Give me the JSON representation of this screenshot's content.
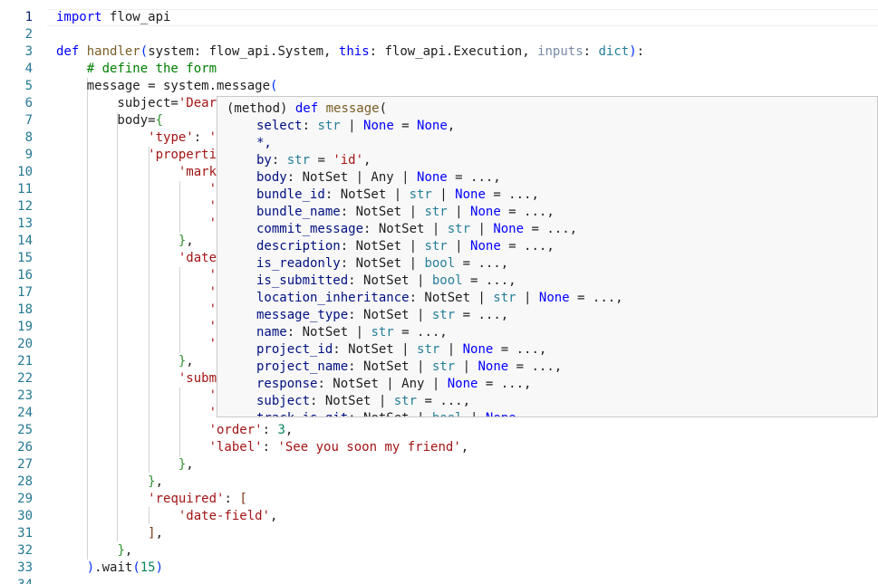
{
  "editor": {
    "active_line": 1,
    "lines": [
      {
        "n": "1",
        "text": "import flow_api"
      },
      {
        "n": "2",
        "text": ""
      },
      {
        "n": "3",
        "text": "def handler(system: flow_api.System, this: flow_api.Execution, inputs: dict):"
      },
      {
        "n": "4",
        "text": "    # define the form"
      },
      {
        "n": "5",
        "text": "    message = system.message("
      },
      {
        "n": "6",
        "text": "        subject='Dear"
      },
      {
        "n": "7",
        "text": "        body={"
      },
      {
        "n": "8",
        "text": "            'type': '"
      },
      {
        "n": "9",
        "text": "            'properti"
      },
      {
        "n": "10",
        "text": "                'mark"
      },
      {
        "n": "11",
        "text": "                    '"
      },
      {
        "n": "12",
        "text": "                    '"
      },
      {
        "n": "13",
        "text": "                    '"
      },
      {
        "n": "14",
        "text": "                },"
      },
      {
        "n": "15",
        "text": "                'date"
      },
      {
        "n": "16",
        "text": "                    '"
      },
      {
        "n": "17",
        "text": "                    '"
      },
      {
        "n": "18",
        "text": "                    '"
      },
      {
        "n": "19",
        "text": "                    '"
      },
      {
        "n": "20",
        "text": "                    '"
      },
      {
        "n": "21",
        "text": "                },"
      },
      {
        "n": "22",
        "text": "                'subm"
      },
      {
        "n": "23",
        "text": "                    '"
      },
      {
        "n": "24",
        "text": "                    '"
      },
      {
        "n": "25",
        "text": "                    'order': 3,"
      },
      {
        "n": "26",
        "text": "                    'label': 'See you soon my friend',"
      },
      {
        "n": "27",
        "text": "                },"
      },
      {
        "n": "28",
        "text": "            },"
      },
      {
        "n": "29",
        "text": "            'required': ["
      },
      {
        "n": "30",
        "text": "                'date-field',"
      },
      {
        "n": "31",
        "text": "            ],"
      },
      {
        "n": "32",
        "text": "        },"
      },
      {
        "n": "33",
        "text": "    ).wait(15)"
      },
      {
        "n": "34",
        "text": ""
      }
    ]
  },
  "hover": {
    "header_prefix": "(method) ",
    "header_kw": "def",
    "header_fn": "message",
    "header_paren": "(",
    "params": [
      {
        "name": "select",
        "sig": ": str | None = None,"
      },
      {
        "name": "*,",
        "sig": ""
      },
      {
        "name": "by",
        "sig": ": str = 'id',"
      },
      {
        "name": "body",
        "sig": ": NotSet | Any | None = ...,"
      },
      {
        "name": "bundle_id",
        "sig": ": NotSet | str | None = ...,"
      },
      {
        "name": "bundle_name",
        "sig": ": NotSet | str | None = ...,"
      },
      {
        "name": "commit_message",
        "sig": ": NotSet | str | None = ...,"
      },
      {
        "name": "description",
        "sig": ": NotSet | str | None = ...,"
      },
      {
        "name": "is_readonly",
        "sig": ": NotSet | bool = ...,"
      },
      {
        "name": "is_submitted",
        "sig": ": NotSet | bool = ...,"
      },
      {
        "name": "location_inheritance",
        "sig": ": NotSet | str | None = ...,"
      },
      {
        "name": "message_type",
        "sig": ": NotSet | str = ...,"
      },
      {
        "name": "name",
        "sig": ": NotSet | str = ...,"
      },
      {
        "name": "project_id",
        "sig": ": NotSet | str | None = ...,"
      },
      {
        "name": "project_name",
        "sig": ": NotSet | str | None = ...,"
      },
      {
        "name": "response",
        "sig": ": NotSet | Any | None = ...,"
      },
      {
        "name": "subject",
        "sig": ": NotSet | str = ...,"
      },
      {
        "name": "track_is_git",
        "sig": ": NotSet | bool | None"
      }
    ]
  },
  "colors": {
    "keyword": "#0000ff",
    "function": "#795e26",
    "string": "#a31515",
    "comment": "#008000",
    "number": "#098658",
    "type": "#267f99",
    "line_number": "#237893"
  }
}
